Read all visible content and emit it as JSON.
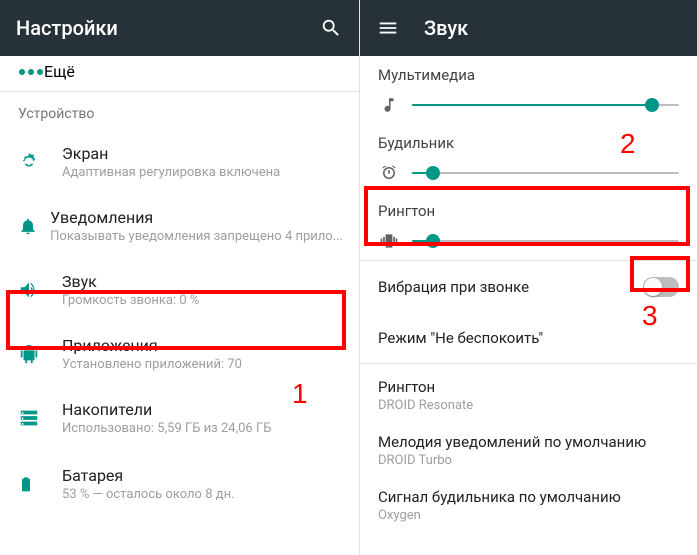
{
  "left": {
    "title": "Настройки",
    "more_label": "Ещё",
    "section": "Устройство",
    "items": [
      {
        "label": "Экран",
        "sub": "Адаптивная регулировка включена"
      },
      {
        "label": "Уведомления",
        "sub": "Показывать уведомления запрещено 4 прило..."
      },
      {
        "label": "Звук",
        "sub": "Громкость звонка: 0 %"
      },
      {
        "label": "Приложения",
        "sub": "Установлено приложений: 70"
      },
      {
        "label": "Накопители",
        "sub": "Использовано: 5,59 ГБ из 24,06 ГБ"
      },
      {
        "label": "Батарея",
        "sub": "53 % — осталось около 8 дн."
      }
    ]
  },
  "right": {
    "title": "Звук",
    "sliders": [
      {
        "title": "Мультимедиа",
        "percent": 90
      },
      {
        "title": "Будильник",
        "percent": 8
      },
      {
        "title": "Рингтон",
        "percent": 8
      }
    ],
    "prefs": [
      {
        "title": "Вибрация при звонке",
        "toggle": false
      },
      {
        "title": "Режим \"Не беспокоить\""
      },
      {
        "title": "Рингтон",
        "sub": "DROID Resonate"
      },
      {
        "title": "Мелодия уведомлений по умолчанию",
        "sub": "DROID Turbo"
      },
      {
        "title": "Сигнал будильника по умолчанию",
        "sub": "Oxygen"
      }
    ]
  },
  "annotations": {
    "n1": "1",
    "n2": "2",
    "n3": "3"
  }
}
